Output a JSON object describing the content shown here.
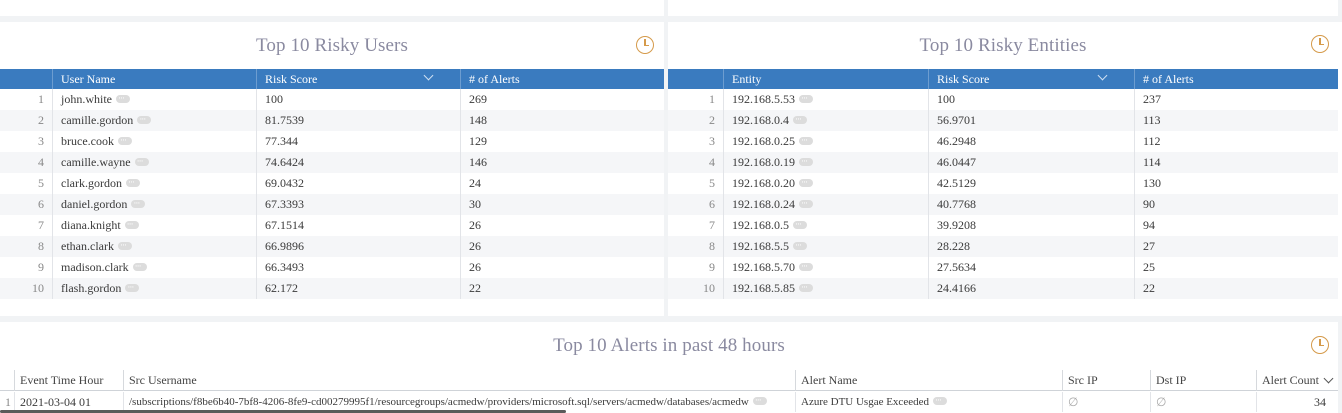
{
  "users_panel": {
    "title": "Top 10 Risky Users",
    "columns": [
      "User Name",
      "Risk Score",
      "# of Alerts"
    ],
    "rows": [
      {
        "idx": "1",
        "name": "john.white",
        "score": "100",
        "alerts": "269"
      },
      {
        "idx": "2",
        "name": "camille.gordon",
        "score": "81.7539",
        "alerts": "148"
      },
      {
        "idx": "3",
        "name": "bruce.cook",
        "score": "77.344",
        "alerts": "129"
      },
      {
        "idx": "4",
        "name": "camille.wayne",
        "score": "74.6424",
        "alerts": "146"
      },
      {
        "idx": "5",
        "name": "clark.gordon",
        "score": "69.0432",
        "alerts": "24"
      },
      {
        "idx": "6",
        "name": "daniel.gordon",
        "score": "67.3393",
        "alerts": "30"
      },
      {
        "idx": "7",
        "name": "diana.knight",
        "score": "67.1514",
        "alerts": "26"
      },
      {
        "idx": "8",
        "name": "ethan.clark",
        "score": "66.9896",
        "alerts": "26"
      },
      {
        "idx": "9",
        "name": "madison.clark",
        "score": "66.3493",
        "alerts": "26"
      },
      {
        "idx": "10",
        "name": "flash.gordon",
        "score": "62.172",
        "alerts": "22"
      }
    ]
  },
  "entities_panel": {
    "title": "Top 10 Risky Entities",
    "columns": [
      "Entity",
      "Risk Score",
      "# of Alerts"
    ],
    "rows": [
      {
        "idx": "1",
        "name": "192.168.5.53",
        "score": "100",
        "alerts": "237"
      },
      {
        "idx": "2",
        "name": "192.168.0.4",
        "score": "56.9701",
        "alerts": "113"
      },
      {
        "idx": "3",
        "name": "192.168.0.25",
        "score": "46.2948",
        "alerts": "112"
      },
      {
        "idx": "4",
        "name": "192.168.0.19",
        "score": "46.0447",
        "alerts": "114"
      },
      {
        "idx": "5",
        "name": "192.168.0.20",
        "score": "42.5129",
        "alerts": "130"
      },
      {
        "idx": "6",
        "name": "192.168.0.24",
        "score": "40.7768",
        "alerts": "90"
      },
      {
        "idx": "7",
        "name": "192.168.0.5",
        "score": "39.9208",
        "alerts": "94"
      },
      {
        "idx": "8",
        "name": "192.168.5.5",
        "score": "28.228",
        "alerts": "27"
      },
      {
        "idx": "9",
        "name": "192.168.5.70",
        "score": "27.5634",
        "alerts": "25"
      },
      {
        "idx": "10",
        "name": "192.168.5.85",
        "score": "24.4166",
        "alerts": "22"
      }
    ]
  },
  "alerts_panel": {
    "title": "Top 10 Alerts in past 48 hours",
    "columns": [
      "Event Time Hour",
      "Src Username",
      "Alert Name",
      "Src IP",
      "Dst IP",
      "Alert Count"
    ],
    "rows": [
      {
        "idx": "1",
        "time": "2021-03-04 01",
        "src_user": "/subscriptions/f8be6b40-7bf8-4206-8fe9-cd00279995f1/resourcegroups/acmedw/providers/microsoft.sql/servers/acmedw/databases/acmedw",
        "alert_name": "Azure DTU Usgae Exceeded",
        "src_ip": "∅",
        "dst_ip": "∅",
        "count": "34"
      }
    ]
  },
  "colors": {
    "header_blue": "#3a7bbf",
    "title_gray": "#8a8aa0",
    "clock_orange": "#d59a4a"
  }
}
